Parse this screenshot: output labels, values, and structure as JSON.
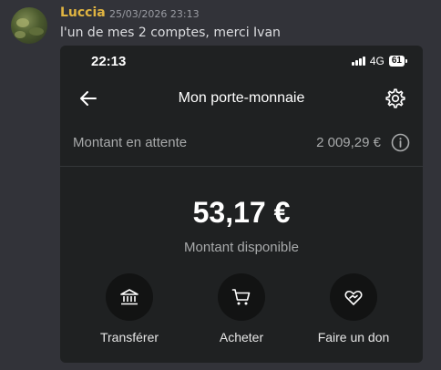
{
  "chat": {
    "author": "Luccia",
    "timestamp": "25/03/2026 23:13",
    "message": "l'un de mes 2 comptes, merci Ivan"
  },
  "phone": {
    "status_bar": {
      "time": "22:13",
      "network": "4G",
      "battery": "61"
    },
    "header": {
      "title": "Mon porte-monnaie",
      "back_icon": "arrow-left-icon",
      "settings_icon": "gear-icon"
    },
    "pending": {
      "label": "Montant en attente",
      "value": "2 009,29 €",
      "icon": "info-icon"
    },
    "balance": {
      "amount": "53,17 €",
      "label": "Montant disponible"
    },
    "actions": [
      {
        "label": "Transférer",
        "icon": "bank-icon"
      },
      {
        "label": "Acheter",
        "icon": "cart-icon"
      },
      {
        "label": "Faire un don",
        "icon": "heart-hand-icon"
      }
    ]
  },
  "colors": {
    "background": "#323339",
    "author": "#e0b441",
    "card": "#1f2122",
    "action_circle": "#121313"
  }
}
